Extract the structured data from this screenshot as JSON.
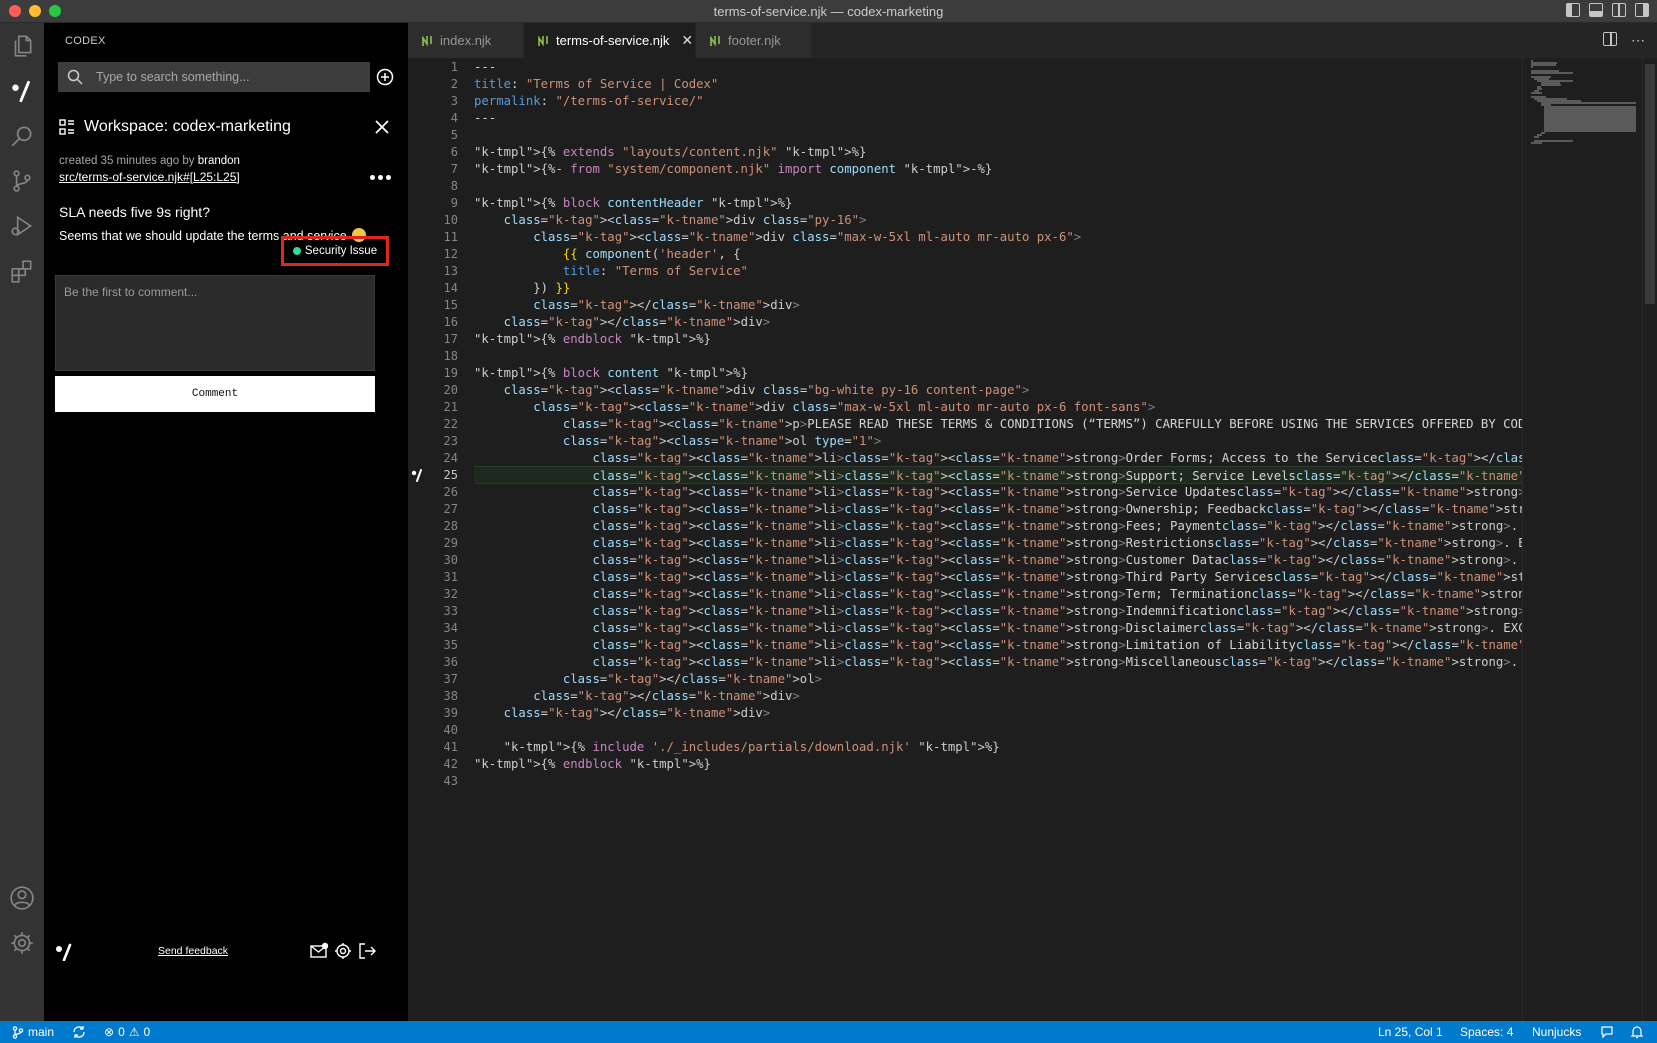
{
  "window": {
    "title": "terms-of-service.njk — codex-marketing"
  },
  "activity_bar": {
    "items": [
      "explorer-icon",
      "codex-icon",
      "search-icon",
      "source-control-icon",
      "run-debug-icon",
      "extensions-icon",
      "account-icon",
      "manage-gear-icon"
    ]
  },
  "sidebar": {
    "header": "CODEX",
    "search_placeholder": "Type to search something...",
    "workspace_title": "Workspace: codex-marketing",
    "meta_prefix": "created 35 minutes ago by",
    "meta_author": "brandon",
    "file_link": "src/terms-of-service.njk#[L25:L25]",
    "question_title": "SLA needs five 9s right?",
    "question_body": "Seems that we should update the terms and service",
    "tag_label": "Security Issue",
    "tag_color": "#2fd8a7",
    "tag_highlight_color": "#e0261b",
    "comment_placeholder": "Be the first to comment...",
    "comment_button": "Comment",
    "feedback_link": "Send feedback"
  },
  "tabs": [
    {
      "label": "index.njk",
      "active": false
    },
    {
      "label": "terms-of-service.njk",
      "active": true
    },
    {
      "label": "footer.njk",
      "active": false
    }
  ],
  "editor": {
    "current_line": 25,
    "lines": [
      "---",
      "title: \"Terms of Service | Codex\"",
      "permalink: \"/terms-of-service/\"",
      "---",
      "",
      "{% extends \"layouts/content.njk\" %}",
      "{%- from \"system/component.njk\" import component -%}",
      "",
      "{% block contentHeader %}",
      "    <div class=\"py-16\">",
      "        <div class=\"max-w-5xl ml-auto mr-auto px-6\">",
      "            {{ component('header', {",
      "            title: \"Terms of Service\"",
      "        }) }}",
      "        </div>",
      "    </div>",
      "{% endblock %}",
      "",
      "{% block content %}",
      "    <div class=\"bg-white py-16 content-page\">",
      "        <div class=\"max-w-5xl ml-auto mr-auto px-6 font-sans\">",
      "            <p>PLEASE READ THESE TERMS & CONDITIONS (“TERMS”) CAREFULLY BEFORE USING THE SERVICES OFFERED BY CODEX BUILD INC. (“Codex”).  BY MUTUA",
      "            <ol type=\"1\">",
      "                <li><strong>Order Forms; Access to the Service</strong>. Upon mutual execution, each Order Form shall be incorporated into and fo",
      "                <li><strong>Support; Service Levels</strong>. Subject to Customer’s payment of all applicable fees, Codex will provide support, ma",
      "                <li><strong>Service Updates</strong>. From time to time, Codex may provide upgrades, patches, enhancements, or fixes for the Serv",
      "                <li><strong>Ownership; Feedback</strong>. As between the parties, Codex retains all right, title, and interest in and to the Serv",
      "                <li><strong>Fees; Payment</strong>. Customer shall pay Codex the fees for the Service as set forth in each Order Form (“Fees”).  U",
      "                <li><strong>Restrictions</strong>. Except as expressly set forth in this Agreement, Customer shall not (and shall not permit any t",
      "                <li><strong>Customer Data</strong>. For purposes of this Agreement, “Customer Data” shall mean any data, information or other mate",
      "                <li><strong>Third Party Services</strong>. Customer acknowledges and agrees that the Service may operate on, with or using applica",
      "                <li><strong>Term; Termination</strong>. This Agreement shall commence upon the date of the first Order Form, and, unless earlier t",
      "                <li><strong>Indemnification</strong>. Each party (“Indemnitor”) shall defend, indemnify, and hold harmless the other party, its a",
      "                <li><strong>Disclaimer</strong>. EXCEPT AS EXPRESSLY SET FORTH IN THIS SECTION 12, THE SERVICE IS PROVIDED “AS IS” AND “AS AVAILAB",
      "                <li><strong>Limitation of Liability</strong>. EXCEPT FOR THE PARTIES’ INDEMNIFICATION OBLIGATIONS AND FOR CUSTOMER’S BREACH OF SEC",
      "                <li><strong>Miscellaneous</strong>. This Agreement represents the entire agreement between Customer and Codex with respect to the",
      "            </ol>",
      "        </div>",
      "    </div>",
      "",
      "    {% include './_includes/partials/download.njk' %}",
      "{% endblock %}",
      ""
    ]
  },
  "status_bar": {
    "branch": "main",
    "errors": "0",
    "warnings": "0",
    "position": "Ln 25, Col 1",
    "spaces": "Spaces: 4",
    "language": "Nunjucks"
  }
}
